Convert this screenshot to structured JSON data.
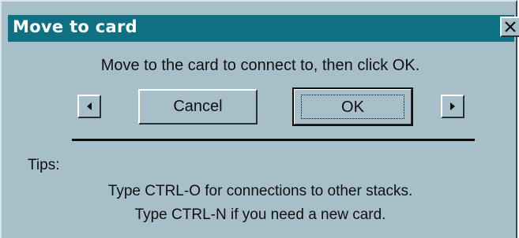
{
  "window": {
    "title": "Move to card",
    "close_glyph": "X",
    "colors": {
      "titlebar": "#0f6f83",
      "face": "#a7bfc8"
    }
  },
  "message": "Move to the card to connect to, then click OK.",
  "buttons": {
    "cancel": "Cancel",
    "ok": "OK",
    "prev_icon": "triangle-left-icon",
    "next_icon": "triangle-right-icon"
  },
  "tips": {
    "label": "Tips:",
    "lines": [
      "Type CTRL-O for connections to other stacks.",
      "Type CTRL-N if you need a new card."
    ]
  }
}
